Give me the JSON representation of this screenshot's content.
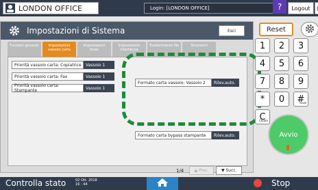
{
  "topbar": {
    "office_label": "LONDON OFFICE",
    "login_text": "Login: [LONDON OFFICE]",
    "help_label": "?",
    "logout_label": "Logout",
    "extra_label": "("
  },
  "window": {
    "title": "Impostazioni di Sistema",
    "esci_label": "Esci"
  },
  "tabs": [
    {
      "label": "Funzioni generali"
    },
    {
      "label": "Impostazioni vassoio carta"
    },
    {
      "label": "Impostazioni timer"
    },
    {
      "label": "Impostazioni interfaccia"
    },
    {
      "label": "Trasferimento file"
    },
    {
      "label": "Strumenti"
    }
  ],
  "rows": [
    {
      "label": "Priorità vassoio carta: Copiatrice",
      "value": "Vassoio 1"
    },
    {
      "label": "Priorità vassoio carta: Fax",
      "value": "Vassoio 1"
    },
    {
      "label": "Priorità vassoio carta: Stampante",
      "value": "Vassoio 1"
    },
    {
      "label": "Formato carta vassoio: Vassoio 2",
      "value": "Rilev.auto."
    },
    {
      "label": "Formato carta bypass stampante",
      "value": "Rilev.auto."
    }
  ],
  "pager": {
    "page": "1/4",
    "prev_label": "Prec.",
    "next_label": "Succ."
  },
  "keypad": {
    "reset_label": "Reset",
    "keys": [
      "1",
      "2",
      "3",
      "4",
      "5",
      "6",
      "7",
      "8",
      "9",
      "*",
      "0",
      "#",
      "C"
    ],
    "hash_sub": "Invio",
    "c_sub": "Chiaro",
    "start_label": "Avvio"
  },
  "bottombar": {
    "status_label": "Controlla stato",
    "date": "02 Ott. 2018",
    "time": "16 : 44",
    "stop_label": "Stop"
  },
  "colors": {
    "accent_orange": "#e58a1c",
    "highlight_green": "#1e8a3a",
    "start_green": "#4ecb68",
    "home_blue": "#2b83c8",
    "stop_red": "#e8463c"
  }
}
